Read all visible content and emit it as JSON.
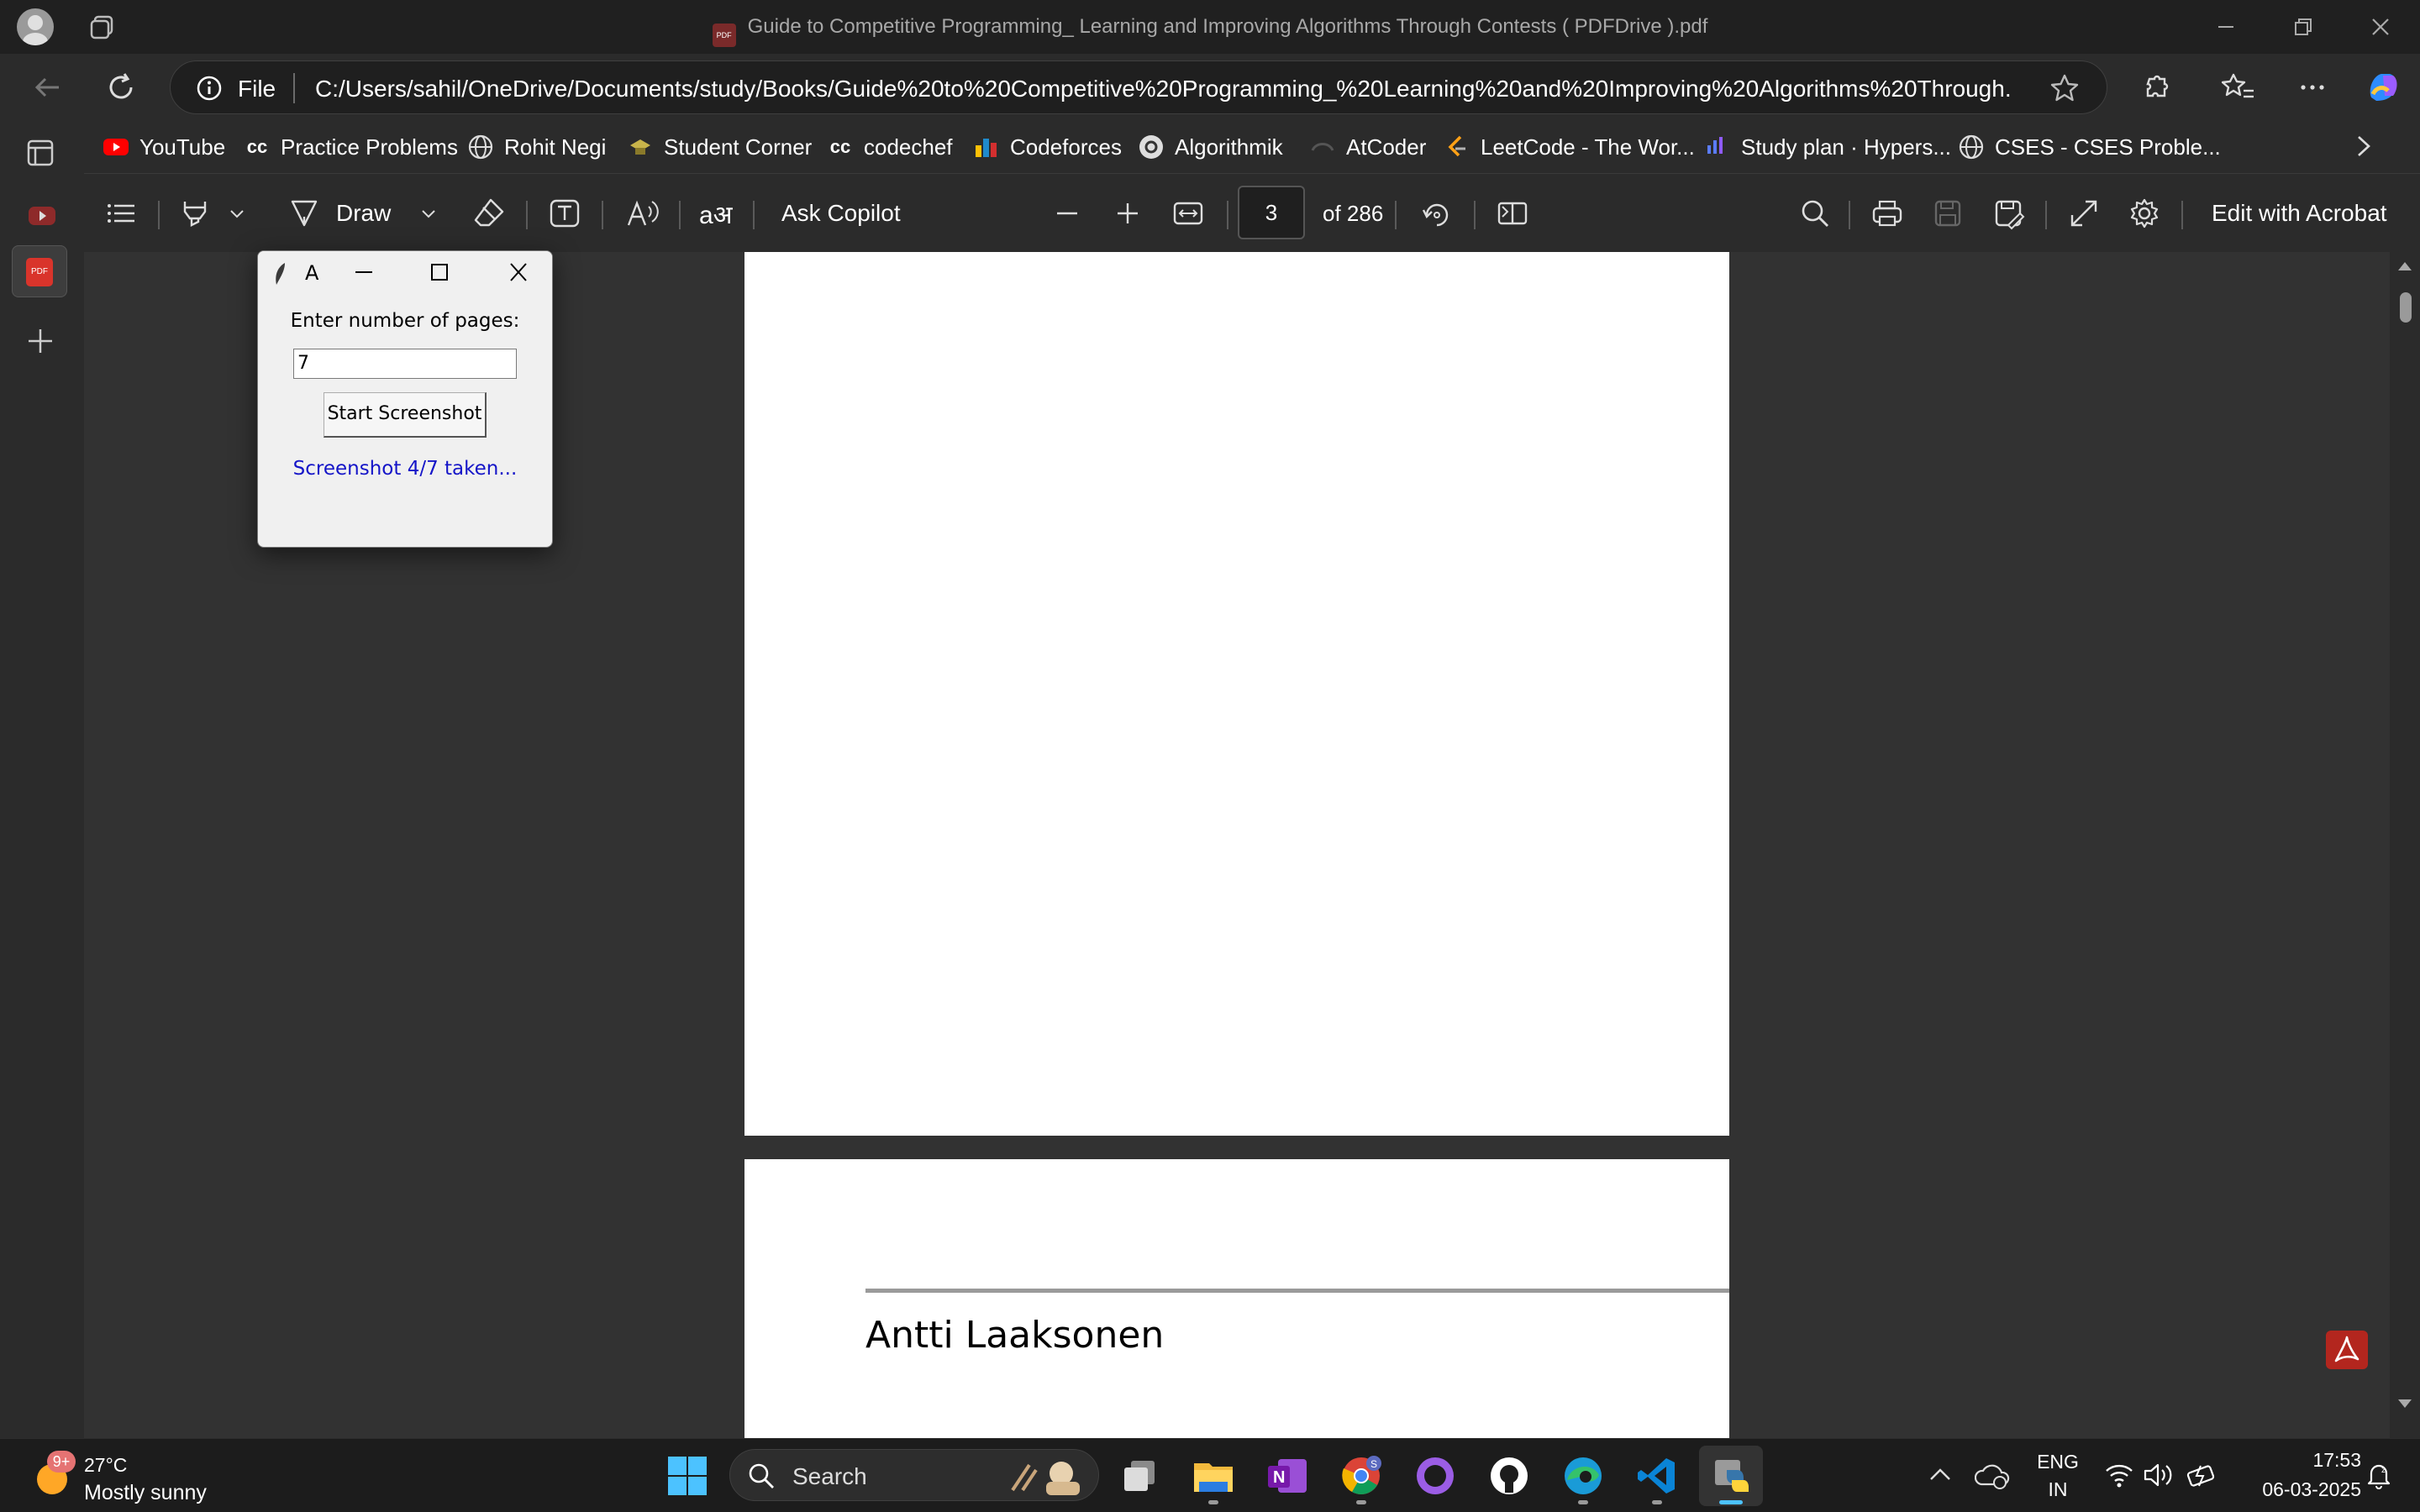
{
  "window": {
    "title": "Guide to Competitive Programming_ Learning and Improving Algorithms Through Contests ( PDFDrive ).pdf"
  },
  "address": {
    "scheme_label": "File",
    "url": "C:/Users/sahil/OneDrive/Documents/study/Books/Guide%20to%20Competitive%20Programming_%20Learning%20and%20Improving%20Algorithms%20Through..."
  },
  "bookmarks": [
    {
      "label": "YouTube",
      "icon": "youtube-icon",
      "color": "#ff0000"
    },
    {
      "label": "Practice Problems",
      "icon": "codechef-cc-icon",
      "color": "#ffffff"
    },
    {
      "label": "Rohit Negi",
      "icon": "globe-icon",
      "color": "#ffffff"
    },
    {
      "label": "Student Corner",
      "icon": "student-corner-icon",
      "color": "#c8b44a"
    },
    {
      "label": "codechef",
      "icon": "codechef-cc-icon",
      "color": "#ffffff"
    },
    {
      "label": "Codeforces",
      "icon": "codeforces-icon",
      "color": "#1f8acb"
    },
    {
      "label": "Algorithmik",
      "icon": "algorithmik-icon",
      "color": "#ffffff"
    },
    {
      "label": "AtCoder",
      "icon": "atcoder-icon",
      "color": "#555555"
    },
    {
      "label": "LeetCode - The Wor...",
      "icon": "leetcode-icon",
      "color": "#ffa116"
    },
    {
      "label": "Study plan · Hypers...",
      "icon": "hyperskill-icon",
      "color": "#5b7cfa"
    },
    {
      "label": "CSES - CSES Proble...",
      "icon": "globe-icon",
      "color": "#ffffff"
    }
  ],
  "pdf_toolbar": {
    "draw_label": "Draw",
    "ask_copilot_label": "Ask Copilot",
    "page_number": "3",
    "page_total_label": "of 286",
    "edit_acrobat_label": "Edit with Acrobat"
  },
  "document": {
    "author": "Antti Laaksonen"
  },
  "dialog": {
    "title": "A",
    "prompt_label": "Enter number of pages:",
    "pages_value": "7",
    "start_button_label": "Start Screenshot",
    "status_text": "Screenshot 4/7 taken..."
  },
  "taskbar": {
    "weather_temp": "27°C",
    "weather_desc": "Mostly sunny",
    "weather_badge": "9+",
    "search_label": "Search",
    "lang_top": "ENG",
    "lang_bottom": "IN",
    "time": "17:53",
    "date": "06-03-2025"
  },
  "colors": {
    "accent_blue": "#0078d4",
    "status_text": "#1515c8",
    "acrobat_red": "#b3261e"
  }
}
